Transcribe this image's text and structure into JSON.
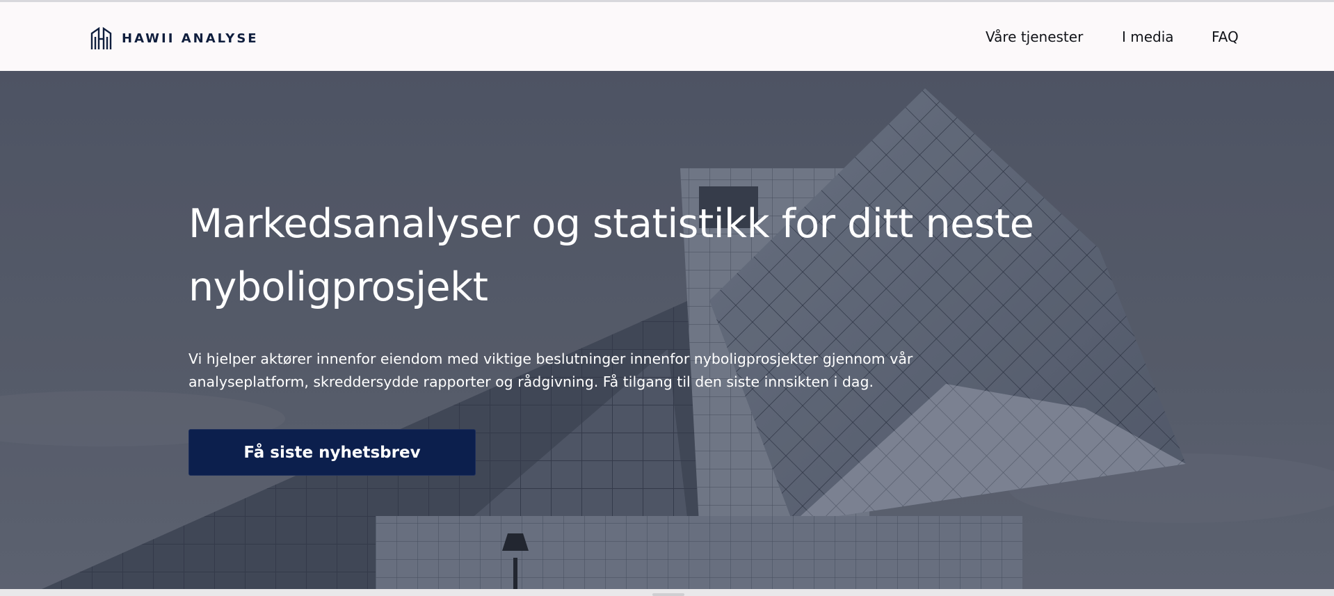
{
  "header": {
    "logo_text": "HAWII ANALYSE",
    "logo_icon": "hawii-house-logo-icon",
    "nav": [
      {
        "label": "Våre tjenester"
      },
      {
        "label": "I media"
      },
      {
        "label": "FAQ"
      }
    ]
  },
  "hero": {
    "title": "Markedsanalyser og statistikk for ditt neste nyboligprosjekt",
    "description": "Vi hjelper aktører innenfor eiendom med viktige beslutninger innenfor nyboligprosjekter gjennom vår analyseplatform, skreddersydde rapporter og rådgivning. Få tilgang til den siste innsikten i dag.",
    "cta_label": "Få siste nyhetsbrev",
    "background": "modern-glass-building-photo"
  },
  "colors": {
    "brand_navy": "#0c1f4d",
    "logo_navy": "#0f1e3d",
    "header_bg": "#fcf9fa",
    "hero_tint": "#575d69"
  }
}
